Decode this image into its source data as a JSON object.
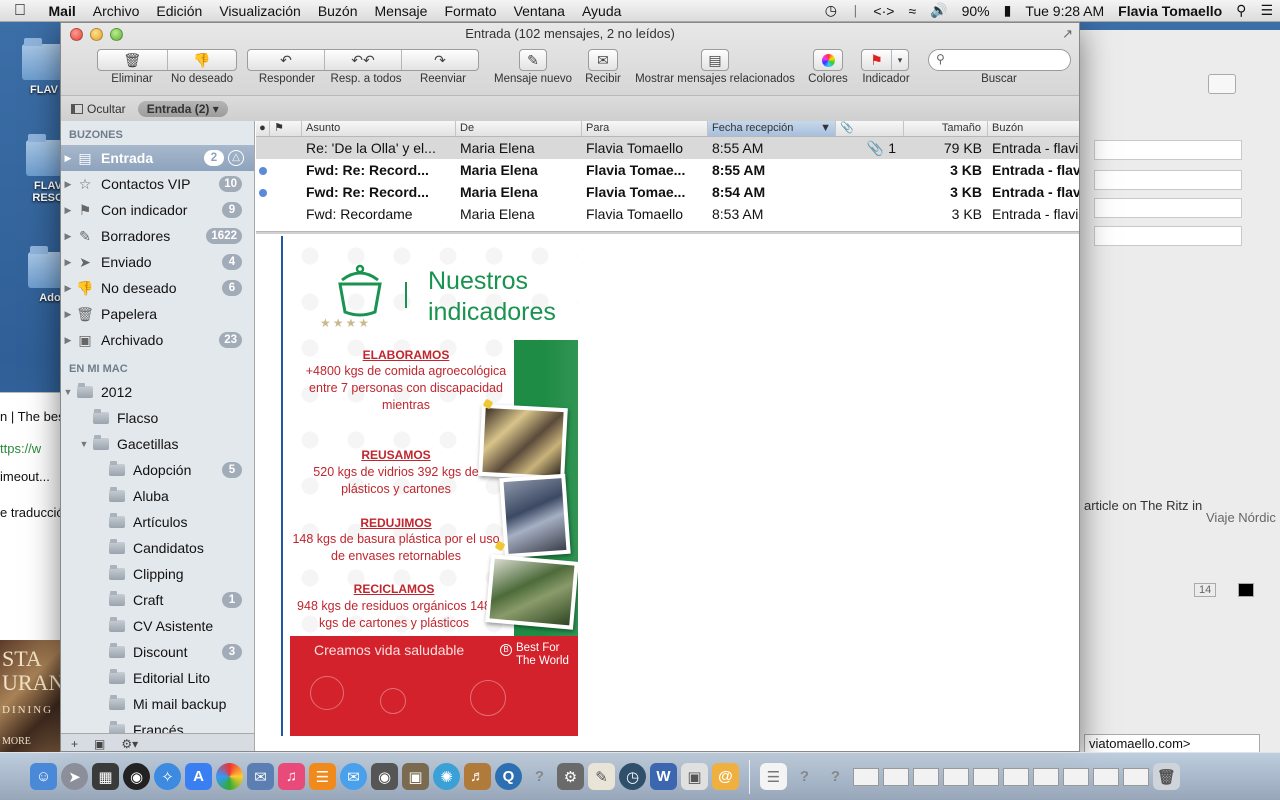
{
  "menubar": {
    "items": [
      "Archivo",
      "Edición",
      "Visualización",
      "Buzón",
      "Mensaje",
      "Formato",
      "Ventana",
      "Ayuda"
    ],
    "app_name": "Mail",
    "battery": "90%",
    "clock": "Tue 9:28 AM",
    "user": "Flavia Tomaello"
  },
  "desktop": {
    "icons": [
      "FLAV",
      "FLAV RESO",
      "Ado"
    ],
    "bg_browser_lines": [
      "n | The bes",
      "ttps://w",
      "imeout...",
      "e traducció"
    ],
    "bg_photo_lines": [
      "STA",
      "URAN",
      "DINING",
      "MORE"
    ],
    "bg_right": {
      "article": "article on The Ritz in",
      "viaje": "Viaje Nórdic",
      "font_size": "14",
      "email": "viatomaello.com>"
    }
  },
  "window": {
    "title": "Entrada (102 mensajes, 2 no leídos)",
    "toolbar": {
      "eliminar": "Eliminar",
      "no_deseado": "No deseado",
      "responder": "Responder",
      "resp_todos": "Resp. a todos",
      "reenviar": "Reenviar",
      "mensaje_nuevo": "Mensaje nuevo",
      "recibir": "Recibir",
      "relacionados": "Mostrar mensajes relacionados",
      "colores": "Colores",
      "indicador": "Indicador",
      "buscar": "Buscar",
      "search_placeholder": ""
    },
    "favorites": {
      "hide": "Ocultar",
      "inbox_pill": "Entrada (2)"
    }
  },
  "sidebar": {
    "mailboxes_heading": "BUZONES",
    "mailboxes": [
      {
        "label": "Entrada",
        "badge": "2",
        "icon": "inbox-icon"
      },
      {
        "label": "Contactos VIP",
        "badge": "10",
        "icon": "star-icon"
      },
      {
        "label": "Con indicador",
        "badge": "9",
        "icon": "flag-icon"
      },
      {
        "label": "Borradores",
        "badge": "1622",
        "icon": "pencil-icon"
      },
      {
        "label": "Enviado",
        "badge": "4",
        "icon": "paper-plane-icon"
      },
      {
        "label": "No deseado",
        "badge": "6",
        "icon": "junk-icon"
      },
      {
        "label": "Papelera",
        "badge": "",
        "icon": "trash-icon"
      },
      {
        "label": "Archivado",
        "badge": "23",
        "icon": "archive-icon"
      }
    ],
    "mac_heading": "EN MI MAC",
    "year_folder": "2012",
    "flacso": "Flacso",
    "gacetillas": "Gacetillas",
    "subfolders": [
      {
        "label": "Adopción",
        "badge": "5"
      },
      {
        "label": "Aluba",
        "badge": ""
      },
      {
        "label": "Artículos",
        "badge": ""
      },
      {
        "label": "Candidatos",
        "badge": ""
      },
      {
        "label": "Clipping",
        "badge": ""
      },
      {
        "label": "Craft",
        "badge": "1"
      },
      {
        "label": "CV Asistente",
        "badge": ""
      },
      {
        "label": "Discount",
        "badge": "3"
      },
      {
        "label": "Editorial Lito",
        "badge": ""
      },
      {
        "label": "Mi mail backup",
        "badge": ""
      },
      {
        "label": "Francés",
        "badge": ""
      }
    ]
  },
  "message_list": {
    "columns": {
      "asunto": "Asunto",
      "de": "De",
      "para": "Para",
      "fecha": "Fecha recepción",
      "tamano": "Tamaño",
      "buzon": "Buzón"
    },
    "rows": [
      {
        "unread": false,
        "subject": "Re: 'De la Olla' y el...",
        "from": "Maria Elena",
        "to": "Flavia Tomaello",
        "date": "8:55 AM",
        "attach": "1",
        "size": "79 KB",
        "mailbox": "Entrada - flavi"
      },
      {
        "unread": true,
        "subject": "Fwd: Re: Record...",
        "from": "Maria Elena",
        "to": "Flavia Tomae...",
        "date": "8:55 AM",
        "attach": "",
        "size": "3 KB",
        "mailbox": "Entrada - flav"
      },
      {
        "unread": true,
        "subject": "Fwd: Re: Record...",
        "from": "Maria Elena",
        "to": "Flavia Tomae...",
        "date": "8:54 AM",
        "attach": "",
        "size": "3 KB",
        "mailbox": "Entrada - flav"
      },
      {
        "unread": false,
        "subject": "Fwd: Recordame",
        "from": "Maria Elena",
        "to": "Flavia Tomaello",
        "date": "8:53 AM",
        "attach": "",
        "size": "3 KB",
        "mailbox": "Entrada - flavi"
      }
    ]
  },
  "preview": {
    "brand_line1": "Nuestros",
    "brand_line2": "indicadores",
    "sections": [
      {
        "title": "ELABORAMOS",
        "body": "+4800 kgs de comida agroecológica entre 7 personas con discapacidad mientras"
      },
      {
        "title": "REUSAMOS",
        "body": "520 kgs de vidrios 392 kgs de plásticos y cartones"
      },
      {
        "title": "REDUJIMOS",
        "body": "148 kgs de basura plástica por el uso de envases retornables"
      },
      {
        "title": "RECICLAMOS",
        "body": "948 kgs de residuos orgánicos 148 kgs de cartones y plásticos"
      }
    ],
    "slogan": "Creamos vida saludable",
    "bftw_line1": "Best For",
    "bftw_line2": "The World"
  }
}
